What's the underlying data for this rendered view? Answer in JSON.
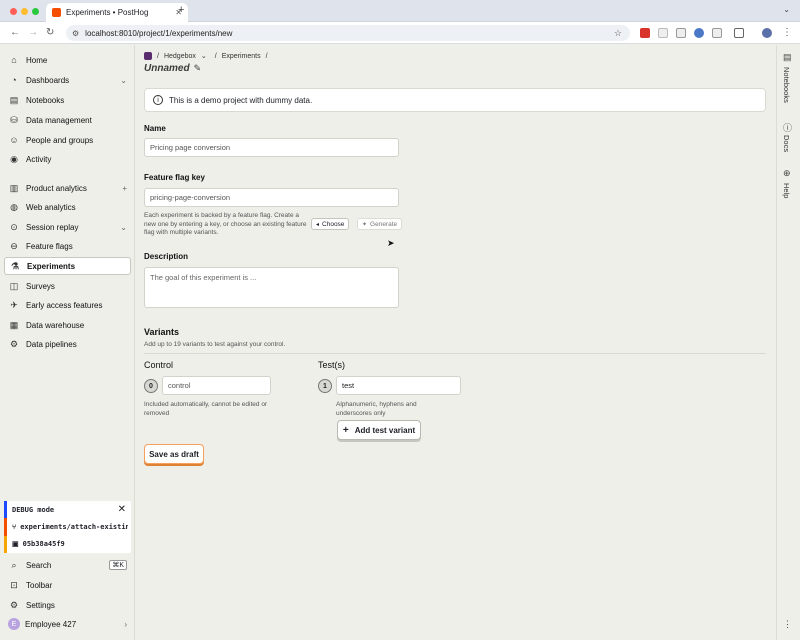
{
  "browser": {
    "tab_title": "Experiments • PostHog",
    "url": "localhost:8010/project/1/experiments/new"
  },
  "sidebar": {
    "items": [
      {
        "label": "Home",
        "icon": "home-icon"
      },
      {
        "label": "Dashboards",
        "icon": "dashboard-icon"
      },
      {
        "label": "Notebooks",
        "icon": "notebook-icon"
      },
      {
        "label": "Data management",
        "icon": "database-icon"
      },
      {
        "label": "People and groups",
        "icon": "people-icon"
      },
      {
        "label": "Activity",
        "icon": "activity-icon"
      },
      {
        "label": "Product analytics",
        "icon": "bar-chart-icon"
      },
      {
        "label": "Web analytics",
        "icon": "globe-icon"
      },
      {
        "label": "Session replay",
        "icon": "replay-icon"
      },
      {
        "label": "Feature flags",
        "icon": "toggle-icon"
      },
      {
        "label": "Experiments",
        "icon": "flask-icon"
      },
      {
        "label": "Surveys",
        "icon": "chat-icon"
      },
      {
        "label": "Early access features",
        "icon": "rocket-icon"
      },
      {
        "label": "Data warehouse",
        "icon": "warehouse-icon"
      },
      {
        "label": "Data pipelines",
        "icon": "pipeline-icon"
      }
    ],
    "debug": {
      "mode": "DEBUG mode",
      "branch": "experiments/attach-existing",
      "commit": "05b38a45f9"
    },
    "bottom": {
      "search": "Search",
      "search_shortcut": "⌘K",
      "toolbar": "Toolbar",
      "settings": "Settings",
      "user": "Employee 427",
      "user_initial": "E"
    }
  },
  "breadcrumb": {
    "project": "Hedgebox",
    "section": "Experiments"
  },
  "page": {
    "title": "Unnamed",
    "banner": "This is a demo project with dummy data."
  },
  "form": {
    "name_label": "Name",
    "name_value": "Pricing page conversion",
    "flag_label": "Feature flag key",
    "flag_value": "pricing-page-conversion",
    "flag_help": "Each experiment is backed by a feature flag. Create a new one by entering a key, or choose an existing feature flag with multiple variants.",
    "choose_label": "Choose",
    "generate_label": "Generate",
    "description_label": "Description",
    "description_placeholder": "The goal of this experiment is ...",
    "variants_label": "Variants",
    "variants_help": "Add up to 19 variants to test against your control.",
    "control_label": "Control",
    "control_index": "0",
    "control_value": "control",
    "control_help": "Included automatically, cannot be edited or removed",
    "tests_label": "Test(s)",
    "test_index": "1",
    "test_value": "test",
    "test_help": "Alphanumeric, hyphens and underscores only",
    "add_variant_label": "Add test variant",
    "save_label": "Save as draft"
  },
  "rail": {
    "notebooks": "Notebooks",
    "docs": "Docs",
    "help": "Help"
  },
  "colors": {
    "accent": "#f54e00",
    "background": "#eeefe9"
  }
}
